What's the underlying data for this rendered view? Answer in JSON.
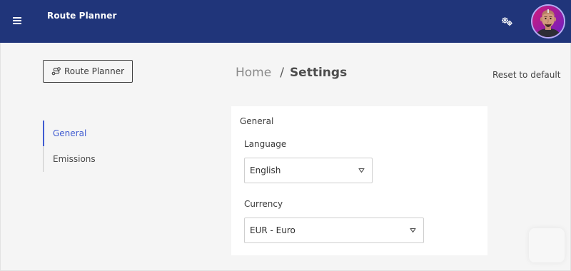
{
  "header": {
    "menu_icon": "hamburger-menu-icon",
    "app_title": "Route Planner",
    "settings_icon": "gears-icon",
    "avatar_icon": "user-avatar",
    "bar_color": "#20357a"
  },
  "sidebar": {
    "route_planner_button": "Route Planner",
    "route_icon": "route-icon",
    "nav": [
      {
        "label": "General",
        "active": true
      },
      {
        "label": "Emissions",
        "active": false
      }
    ],
    "accent_color": "#3f5bd1"
  },
  "breadcrumb": {
    "home": "Home",
    "separator": "/",
    "current": "Settings"
  },
  "reset_label": "Reset to default",
  "general_card": {
    "title": "General",
    "language": {
      "label": "Language",
      "value": "English"
    },
    "currency": {
      "label": "Currency",
      "value": "EUR - Euro"
    }
  }
}
